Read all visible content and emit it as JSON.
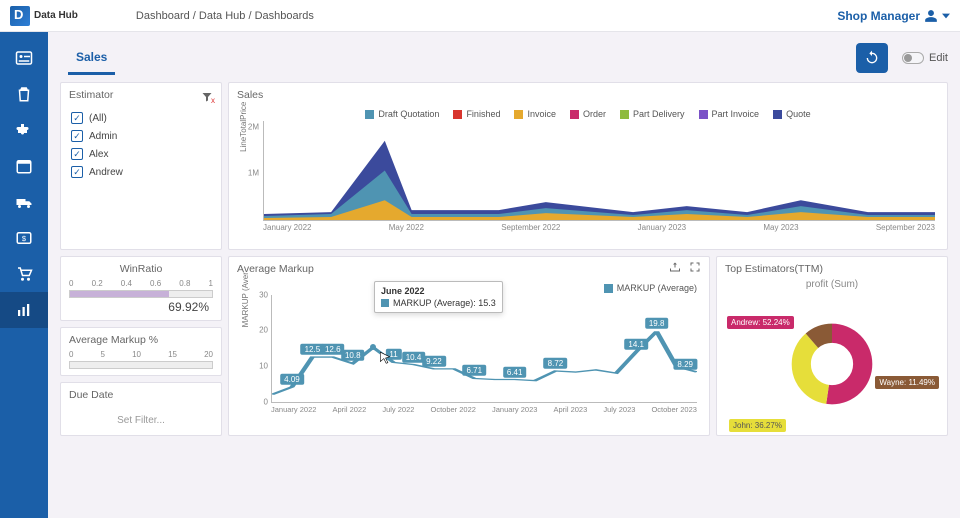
{
  "app": {
    "logo_text": "Data Hub"
  },
  "breadcrumb": [
    "Dashboard",
    "Data Hub",
    "Dashboards"
  ],
  "user_role": "Shop Manager",
  "tabs": {
    "sales": "Sales"
  },
  "topbar": {
    "edit": "Edit"
  },
  "filters": {
    "estimator": {
      "title": "Estimator",
      "items": [
        "(All)",
        "Admin",
        "Alex",
        "Andrew"
      ]
    },
    "due_date": {
      "title": "Due Date",
      "placeholder": "Set Filter..."
    }
  },
  "winratio": {
    "title": "WinRatio",
    "scale": [
      "0",
      "0.2",
      "0.4",
      "0.6",
      "0.8",
      "1"
    ],
    "value_pct": 69.92,
    "value_label": "69.92%"
  },
  "avg_markup_pct": {
    "title": "Average Markup %",
    "scale": [
      "0",
      "5",
      "10",
      "15",
      "20"
    ]
  },
  "sales": {
    "title": "Sales",
    "ylabel": "LineTotalPrice",
    "yticks": [
      "2M",
      "1M"
    ],
    "legend": [
      {
        "label": "Draft Quotation",
        "color": "#4f94b2"
      },
      {
        "label": "Finished",
        "color": "#d8352e"
      },
      {
        "label": "Invoice",
        "color": "#e5a92e"
      },
      {
        "label": "Order",
        "color": "#c92a6a"
      },
      {
        "label": "Part Delivery",
        "color": "#8fbb3e"
      },
      {
        "label": "Part Invoice",
        "color": "#7a52c7"
      },
      {
        "label": "Quote",
        "color": "#3b4a9c"
      }
    ],
    "x": [
      "January 2022",
      "May 2022",
      "September 2022",
      "January 2023",
      "May 2023",
      "September 2023"
    ]
  },
  "markup": {
    "title": "Average Markup",
    "legend_label": "MARKUP (Average)",
    "ylabel": "MARKUP (Aver",
    "yticks": [
      "30",
      "20",
      "10",
      "0"
    ],
    "x": [
      "January 2022",
      "April 2022",
      "July 2022",
      "October 2022",
      "January 2023",
      "April 2023",
      "July 2023",
      "October 2023"
    ],
    "tooltip": {
      "title": "June 2022",
      "metric": "MARKUP (Average): 15.3"
    }
  },
  "top_estimators": {
    "title": "Top Estimators(TTM)",
    "chart_title": "profit (Sum)",
    "slices": [
      {
        "label": "Andrew: 52.24%",
        "color": "#c92a6a"
      },
      {
        "label": "John: 36.27%",
        "color": "#e6de3a"
      },
      {
        "label": "Wayne: 11.49%",
        "color": "#8a5a36"
      }
    ]
  },
  "chart_data": [
    {
      "type": "area",
      "title": "Sales",
      "ylabel": "LineTotalPrice",
      "x_axis_labels": [
        "January 2022",
        "May 2022",
        "September 2022",
        "January 2023",
        "May 2023",
        "September 2023"
      ],
      "ylim": [
        0,
        2000000
      ],
      "series_names": [
        "Draft Quotation",
        "Finished",
        "Invoice",
        "Order",
        "Part Delivery",
        "Part Invoice",
        "Quote"
      ],
      "note": "stacked area; dominant peak ~1.6M at May 2022, low baseline ~0.15M other months"
    },
    {
      "type": "line",
      "title": "Average Markup",
      "ylabel": "MARKUP (Average)",
      "series": [
        {
          "name": "MARKUP (Average)",
          "x": [
            "Jan 2022",
            "Feb 2022",
            "Mar 2022",
            "Apr 2022",
            "May 2022",
            "Jun 2022",
            "Jul 2022",
            "Aug 2022",
            "Sep 2022",
            "Oct 2022",
            "Nov 2022",
            "Dec 2022",
            "Jan 2023",
            "Feb 2023",
            "Mar 2023",
            "Apr 2023",
            "May 2023",
            "Jun 2023",
            "Jul 2023",
            "Aug 2023",
            "Sep 2023",
            "Oct 2023"
          ],
          "values": [
            2.0,
            4.09,
            12.5,
            12.6,
            10.8,
            15.3,
            11.0,
            10.4,
            9.22,
            9.2,
            6.71,
            6.2,
            6.41,
            6.0,
            8.72,
            8.5,
            9.0,
            8.0,
            14.1,
            19.8,
            10.0,
            8.29
          ]
        }
      ],
      "ylim": [
        0,
        30
      ],
      "labeled_points": {
        "Feb 2022": 4.09,
        "Jun 2022": 15.3,
        "Sep 2022": 9.22,
        "Nov 2022": 6.71,
        "Jan 2023": 6.41,
        "Mar 2023": 8.72,
        "Jul 2023": 14.1,
        "Aug 2023": 19.8,
        "Oct 2023": 8.29
      }
    },
    {
      "type": "bar",
      "title": "WinRatio",
      "categories": [
        "WinRatio"
      ],
      "values": [
        0.6992
      ],
      "xlim": [
        0,
        1
      ]
    },
    {
      "type": "pie",
      "title": "Top Estimators(TTM) — profit (Sum)",
      "categories": [
        "Andrew",
        "John",
        "Wayne"
      ],
      "values": [
        52.24,
        36.27,
        11.49
      ]
    }
  ]
}
